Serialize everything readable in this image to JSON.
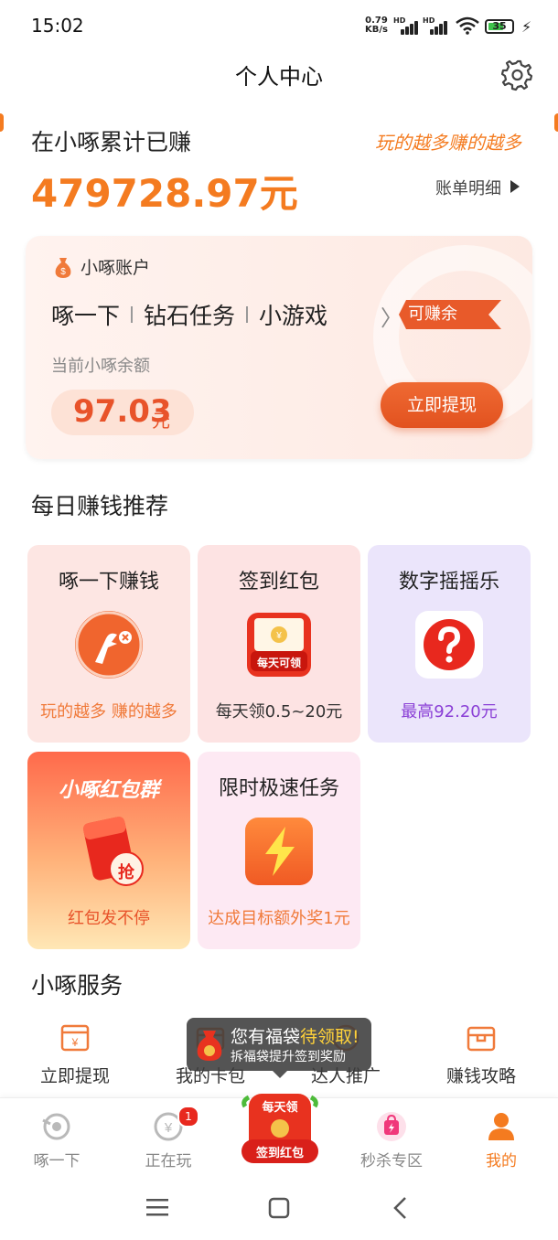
{
  "status_bar": {
    "time": "15:02",
    "net_speed_value": "0.79",
    "net_speed_unit": "KB/s",
    "signal_label_1": "HD",
    "signal_label_2": "HD",
    "battery_level": "35"
  },
  "header": {
    "title": "个人中心",
    "settings_icon": "gear-icon"
  },
  "earnings": {
    "label": "在小啄累计已赚",
    "slogan": "玩的越多赚的越多",
    "amount": "479728.97元",
    "bill_link": "账单明细"
  },
  "account": {
    "title": "小啄账户",
    "tags": [
      "啄一下",
      "钻石任务",
      "小游戏"
    ],
    "tag_label": "可赚余额",
    "balance_label": "当前小啄余额",
    "balance_value": "97.03",
    "balance_unit": "元",
    "withdraw_button": "立即提现"
  },
  "daily": {
    "title": "每日赚钱推荐",
    "tiles": [
      {
        "title": "啄一下赚钱",
        "subtitle": "玩的越多 赚的越多",
        "subtitle_color": "#f07a3a",
        "icon": "woodpecker-icon"
      },
      {
        "title": "签到红包",
        "subtitle": "每天领0.5~20元",
        "subtitle_color": "#333333",
        "icon": "red-envelope-icon",
        "icon_text": "每天可领"
      },
      {
        "title": "数字摇摇乐",
        "subtitle": "最高92.20元",
        "subtitle_color": "#8a3fd6",
        "icon": "question-icon"
      },
      {
        "title": "小啄红包群",
        "subtitle": "红包发不停",
        "subtitle_color": "#e8532a",
        "icon": "red-packet-icon",
        "icon_text": "抢"
      },
      {
        "title": "限时极速任务",
        "subtitle": "达成目标额外奖1元",
        "subtitle_color": "#f07a3a",
        "icon": "lightning-icon"
      }
    ]
  },
  "services": {
    "title": "小啄服务",
    "items": [
      {
        "label": "立即提现",
        "icon": "withdraw-icon"
      },
      {
        "label": "我的卡包",
        "icon": "card-wallet-icon"
      },
      {
        "label": "达人推广",
        "icon": "promotion-icon"
      },
      {
        "label": "赚钱攻略",
        "icon": "guide-icon"
      }
    ]
  },
  "tooltip": {
    "line1_prefix": "您有福袋",
    "line1_highlight": "待领取!",
    "line2": "拆福袋提升签到奖励"
  },
  "tabbar": {
    "items": [
      {
        "label": "啄一下",
        "icon": "peck-icon"
      },
      {
        "label": "正在玩",
        "icon": "playing-icon",
        "badge": "1"
      },
      {
        "label": "秒杀专区",
        "icon": "flash-sale-icon"
      },
      {
        "label": "我的",
        "icon": "profile-icon",
        "active": true
      }
    ],
    "center": {
      "top_text": "每天领",
      "bottom_text": "签到红包"
    }
  },
  "colors": {
    "accent": "#f47b20",
    "button": "#e8532a",
    "purple": "#8a3fd6"
  }
}
